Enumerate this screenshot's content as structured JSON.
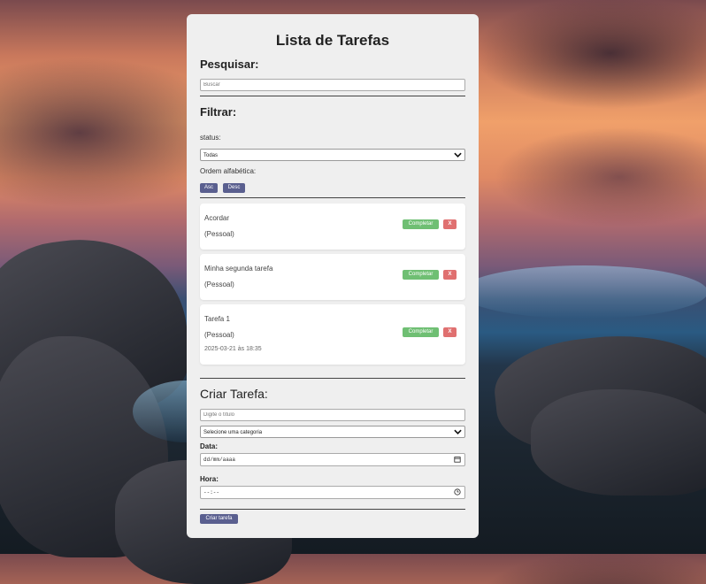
{
  "title": "Lista de Tarefas",
  "search": {
    "heading": "Pesquisar:",
    "placeholder": "Buscar"
  },
  "filter": {
    "heading": "Filtrar:",
    "status_label": "status:",
    "status_value": "Todas",
    "order_label": "Ordem alfabética:",
    "asc_label": "Asc",
    "desc_label": "Desc"
  },
  "tasks": [
    {
      "title": "Acordar",
      "category": "(Pessoal)",
      "date": ""
    },
    {
      "title": "Minha segunda tarefa",
      "category": "(Pessoal)",
      "date": ""
    },
    {
      "title": "Tarefa 1",
      "category": "(Pessoal)",
      "date": "2025-03-21 às 18:35"
    }
  ],
  "task_actions": {
    "complete_label": "Completar",
    "delete_label": "X"
  },
  "create": {
    "heading": "Criar Tarefa:",
    "title_placeholder": "Digite o título",
    "category_value": "Selecione uma categoria",
    "date_label": "Data:",
    "date_value": "dd/mm/aaaa",
    "time_label": "Hora:",
    "time_value": "--:--",
    "submit_label": "Criar tarefa"
  },
  "colors": {
    "primary_button": "#5a5f8f",
    "complete_button": "#6fbf73",
    "delete_button": "#e07070"
  },
  "icons": {
    "select": "chevron-down-icon",
    "date": "calendar-icon",
    "time": "clock-icon"
  }
}
